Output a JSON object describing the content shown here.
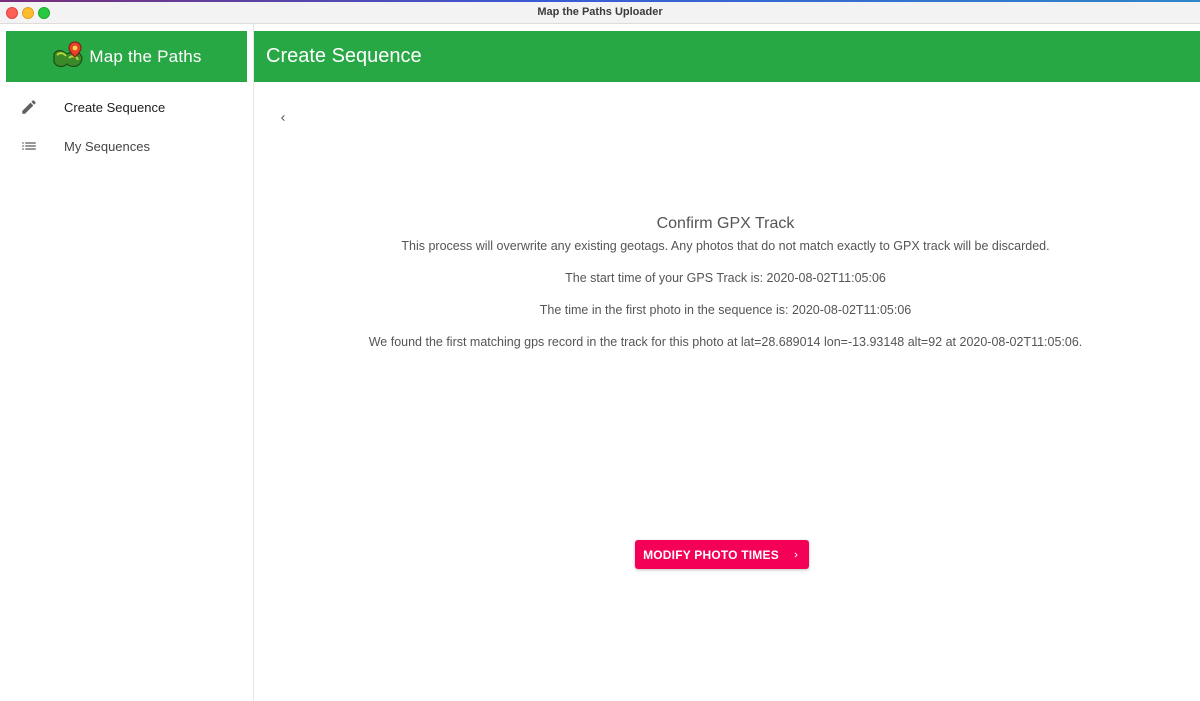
{
  "window": {
    "title": "Map the Paths Uploader"
  },
  "sidebar": {
    "brand_label": "Map the Paths",
    "items": [
      {
        "label": "Create Sequence",
        "icon": "pencil-icon"
      },
      {
        "label": "My Sequences",
        "icon": "list-icon"
      }
    ]
  },
  "header": {
    "title": "Create Sequence"
  },
  "main": {
    "heading": "Confirm GPX Track",
    "lines": [
      "This process will overwrite any existing geotags. Any photos that do not match exactly to GPX track will be discarded.",
      "The start time of your GPS Track is: 2020-08-02T11:05:06",
      "The time in the first photo in the sequence is: 2020-08-02T11:05:06",
      "We found the first matching gps record in the track for this photo at lat=28.689014 lon=-13.93148 alt=92 at 2020-08-02T11:05:06."
    ],
    "primary_button_label": "MODIFY PHOTO TIMES"
  },
  "colors": {
    "brand_green": "#28a745",
    "accent_pink": "#f50057"
  }
}
